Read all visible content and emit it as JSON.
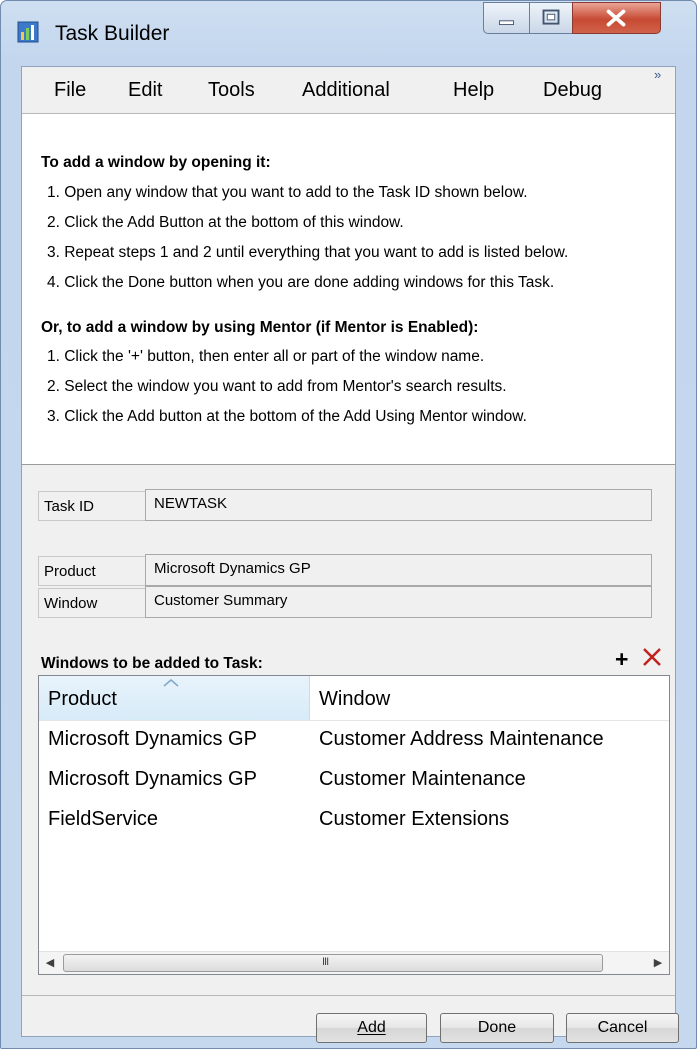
{
  "window": {
    "title": "Task Builder"
  },
  "menu": {
    "items": [
      "File",
      "Edit",
      "Tools",
      "Additional",
      "Help",
      "Debug"
    ],
    "overflow": "»"
  },
  "instructions": {
    "section1_title": "To add a window by opening it:",
    "section1_steps": [
      "1. Open any window that you want to add to the Task ID shown below.",
      "2. Click the Add Button at the bottom of this window.",
      "3. Repeat steps 1 and 2 until everything that you want to add is listed below.",
      "4. Click the Done button when you are done adding windows for this Task."
    ],
    "section2_title": "Or, to add a window by using Mentor (if Mentor is Enabled):",
    "section2_steps": [
      "1. Click the '+' button, then enter all or part of the window name.",
      "2. Select the window you want to add from Mentor's search results.",
      "3. Click the Add button at the bottom of the Add Using Mentor window."
    ]
  },
  "fields": {
    "task_id_label": "Task ID",
    "task_id_value": "NEWTASK",
    "product_label": "Product",
    "product_value": "Microsoft Dynamics GP",
    "window_label": "Window",
    "window_value": "Customer Summary"
  },
  "list": {
    "title": "Windows to be added to Task:",
    "add_icon": "plus-icon",
    "delete_icon": "red-x-icon",
    "columns": [
      "Product",
      "Window"
    ],
    "rows": [
      [
        "Microsoft Dynamics GP",
        "Customer Address Maintenance"
      ],
      [
        "Microsoft Dynamics GP",
        "Customer Maintenance"
      ],
      [
        "FieldService",
        "Customer Extensions"
      ]
    ],
    "scroll_grip": "III"
  },
  "buttons": {
    "add": "Add",
    "done": "Done",
    "cancel": "Cancel"
  },
  "colors": {
    "frame": "#c3d6ee",
    "close_button": "#c74a33",
    "delete_icon": "#c0221d",
    "header_highlight": "#d7ebf8"
  }
}
